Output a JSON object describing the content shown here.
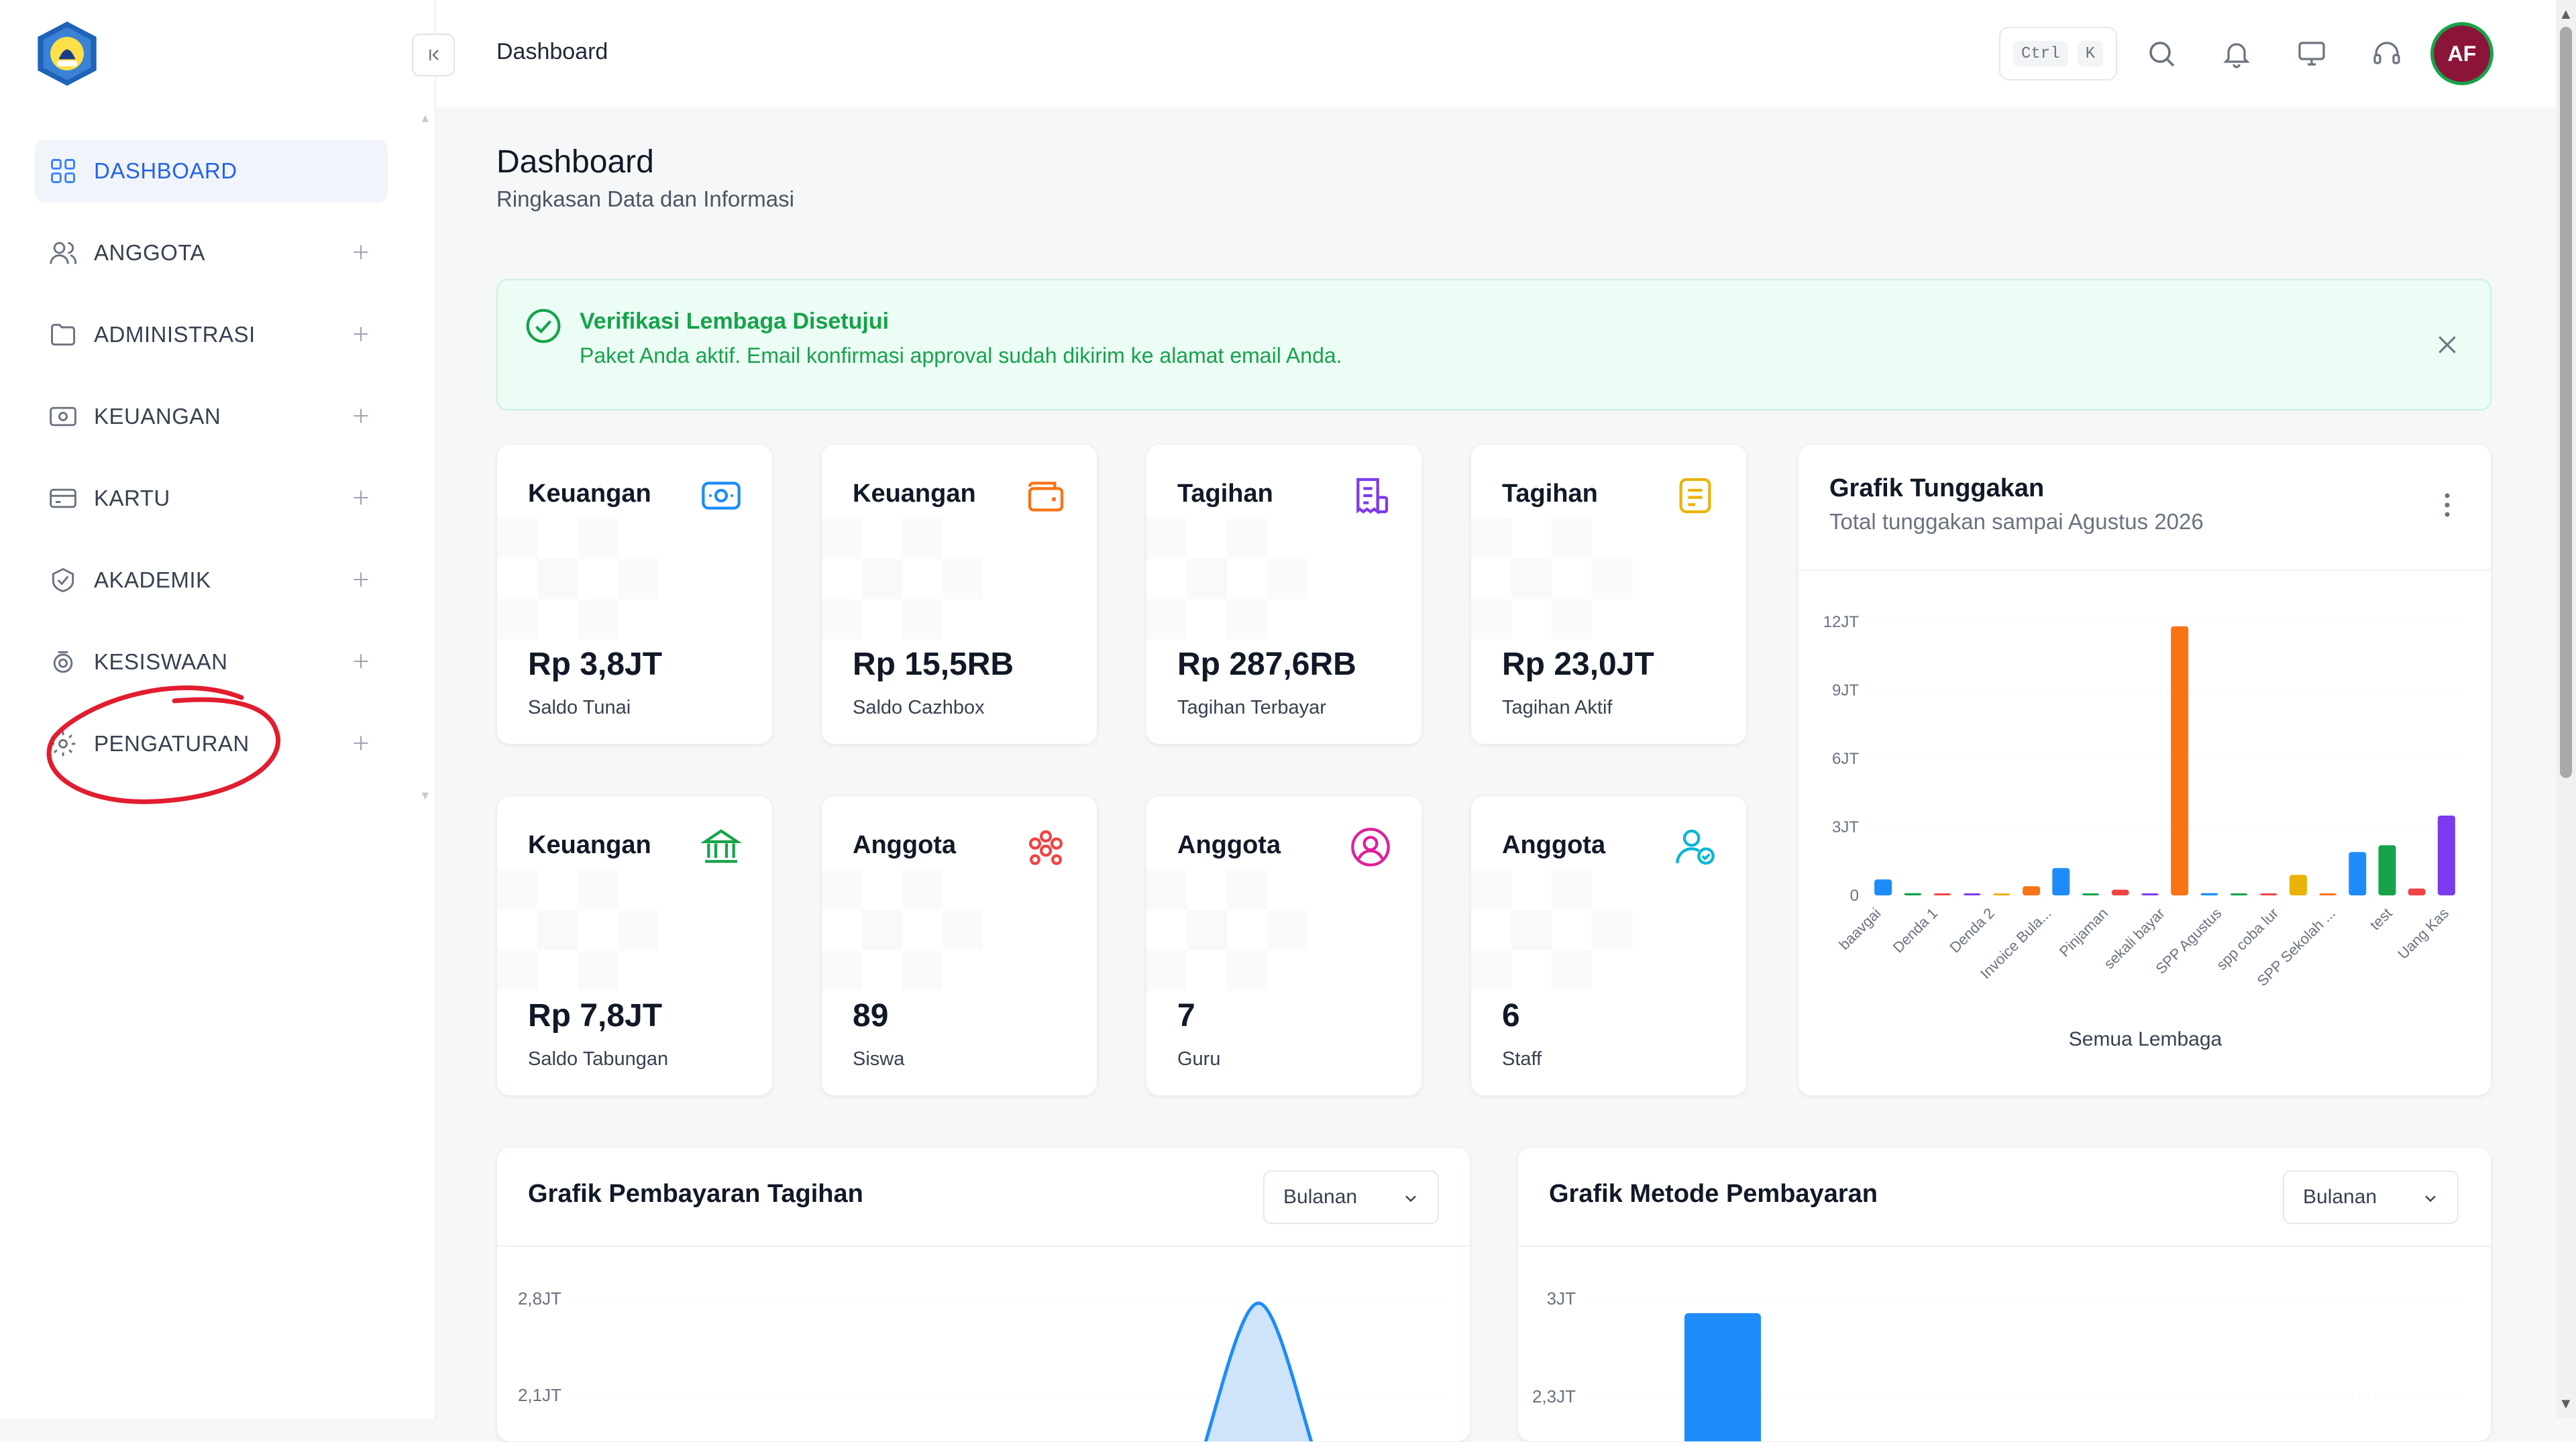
{
  "sidebar": {
    "items": [
      {
        "label": "DASHBOARD",
        "icon": "dashboard-icon"
      },
      {
        "label": "ANGGOTA",
        "icon": "users-icon"
      },
      {
        "label": "ADMINISTRASI",
        "icon": "folder-icon"
      },
      {
        "label": "KEUANGAN",
        "icon": "money-icon"
      },
      {
        "label": "KARTU",
        "icon": "card-icon"
      },
      {
        "label": "AKADEMIK",
        "icon": "academic-icon"
      },
      {
        "label": "KESISWAAN",
        "icon": "student-icon"
      },
      {
        "label": "PENGATURAN",
        "icon": "settings-icon"
      }
    ],
    "active_index": 0,
    "annotation_color": "#e11d2e"
  },
  "topbar": {
    "breadcrumb": "Dashboard",
    "shortcut_ctrl": "Ctrl",
    "shortcut_key": "K",
    "avatar_initials": "AF",
    "avatar_color": "#8b1538"
  },
  "page": {
    "title": "Dashboard",
    "subtitle": "Ringkasan Data dan Informasi"
  },
  "alert": {
    "title": "Verifikasi Lembaga Disetujui",
    "message": "Paket Anda aktif. Email konfirmasi approval sudah dikirim ke alamat email Anda.",
    "color": "#16a34a"
  },
  "stats": [
    {
      "title": "Keuangan",
      "value": "Rp 3,8JT",
      "label": "Saldo Tunai",
      "icon": "cash-icon",
      "color": "#1d8cf8"
    },
    {
      "title": "Keuangan",
      "value": "Rp 15,5RB",
      "label": "Saldo Cazhbox",
      "icon": "wallet-icon",
      "color": "#f97316"
    },
    {
      "title": "Tagihan",
      "value": "Rp 287,6RB",
      "label": "Tagihan Terbayar",
      "icon": "receipt-icon",
      "color": "#7c3aed"
    },
    {
      "title": "Tagihan",
      "value": "Rp 23,0JT",
      "label": "Tagihan Aktif",
      "icon": "invoice-icon",
      "color": "#eab308"
    },
    {
      "title": "Keuangan",
      "value": "Rp 7,8JT",
      "label": "Saldo Tabungan",
      "icon": "bank-icon",
      "color": "#16a34a"
    },
    {
      "title": "Anggota",
      "value": "89",
      "label": "Siswa",
      "icon": "group-icon",
      "color": "#ef4444"
    },
    {
      "title": "Anggota",
      "value": "7",
      "label": "Guru",
      "icon": "user-circle-icon",
      "color": "#e11d9b"
    },
    {
      "title": "Anggota",
      "value": "6",
      "label": "Staff",
      "icon": "user-check-icon",
      "color": "#06b6d4"
    }
  ],
  "tunggakan": {
    "title": "Grafik Tunggakan",
    "subtitle": "Total tunggakan sampai Agustus 2026",
    "xlabel": "Semua Lembaga"
  },
  "pembayaran": {
    "title": "Grafik Pembayaran Tagihan",
    "select": "Bulanan"
  },
  "metode": {
    "title": "Grafik Metode Pembayaran",
    "select": "Bulanan"
  },
  "chart_data": [
    {
      "type": "bar",
      "title": "Grafik Tunggakan",
      "xlabel": "Semua Lembaga",
      "ylabel": "",
      "ylim": [
        0,
        12000000
      ],
      "yticks": [
        "0",
        "3JT",
        "6JT",
        "9JT",
        "12JT"
      ],
      "categories": [
        "baavgai",
        "",
        "Denda 1",
        "",
        "Denda 2",
        "",
        "Invoice Bula...",
        "",
        "Pinjaman",
        "",
        "sekali bayar",
        "",
        "SPP Agustus",
        "",
        "spp coba lur",
        "",
        "SPP Sekolah ...",
        "",
        "test",
        "",
        "Uang Kas",
        ""
      ],
      "values": [
        700000,
        100000,
        80000,
        60000,
        40000,
        400000,
        1200000,
        50000,
        250000,
        60000,
        11800000,
        100000,
        80000,
        0,
        900000,
        0,
        1900000,
        2200000,
        300000,
        3500000
      ],
      "bar_colors": [
        "#1d8cf8",
        "#16a34a",
        "#ef4444",
        "#7c3aed",
        "#eab308",
        "#f97316",
        "#1d8cf8",
        "#16a34a",
        "#ef4444",
        "#7c3aed",
        "#f97316",
        "#1d8cf8",
        "#16a34a",
        "#ef4444",
        "#eab308",
        "#f97316",
        "#1d8cf8",
        "#16a34a",
        "#ef4444",
        "#7c3aed"
      ],
      "label_slots": [
        "baavgai",
        "Denda 1",
        "Denda 2",
        "Invoice Bula...",
        "Pinjaman",
        "sekali bayar",
        "SPP Agustus",
        "spp coba lur",
        "SPP Sekolah ...",
        "test",
        "Uang Kas"
      ]
    },
    {
      "type": "area",
      "title": "Grafik Pembayaran Tagihan",
      "yticks": [
        "2,8JT",
        "2,1JT"
      ],
      "ylim": [
        2100000,
        2800000
      ],
      "peak_value": 2800000
    },
    {
      "type": "bar",
      "title": "Grafik Metode Pembayaran",
      "yticks": [
        "3JT",
        "2,3JT"
      ],
      "ylim": [
        2300000,
        3000000
      ],
      "values": [
        2900000
      ]
    }
  ]
}
